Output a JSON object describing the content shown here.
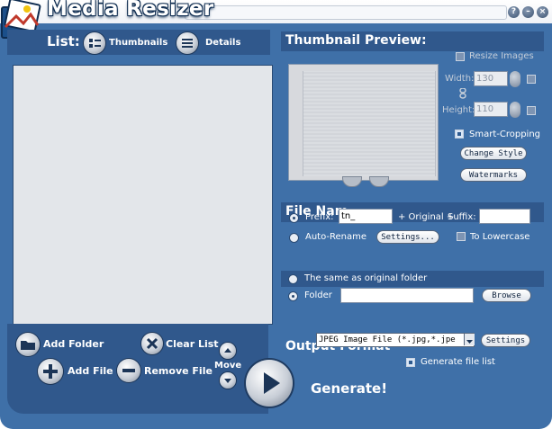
{
  "window": {
    "title": "Media Resizer",
    "help_glyph": "?",
    "minimize_glyph": "–",
    "close_glyph": "×"
  },
  "list": {
    "label": "List:",
    "thumbnails_label": "Thumbnails",
    "details_label": "Details"
  },
  "actions": {
    "add_folder": "Add Folder",
    "add_file": "Add File",
    "clear_list": "Clear List",
    "remove_file": "Remove File",
    "move": "Move",
    "generate": "Generate!"
  },
  "preview": {
    "title": "Thumbnail Preview:",
    "resize_images": "Resize Images",
    "width_label": "Width:",
    "width_value": "130",
    "height_label": "Height:",
    "height_value": "110",
    "smart_cropping": "Smart-Cropping",
    "change_style": "Change Style",
    "watermarks": "Watermarks"
  },
  "file_name": {
    "title": "File Nam",
    "prefix_label": "Prefix:",
    "prefix_value": "tn_",
    "original_label": "+ Original +",
    "suffix_label": "Suffix:",
    "suffix_value": "",
    "auto_rename": "Auto-Rename",
    "settings": "Settings...",
    "to_lowercase": "To Lowercase"
  },
  "output": {
    "same_as_original": "The same as original folder",
    "folder_label": "Folder",
    "folder_value": "",
    "browse": "Browse",
    "format_title": "Output Format",
    "format_value": "JPEG Image File (*.jpg,*.jpe",
    "settings": "Settings",
    "generate_file_list": "Generate file list"
  },
  "colors": {
    "body": "#3f70a8",
    "panel": "#30588c",
    "text": "#ffffff"
  }
}
